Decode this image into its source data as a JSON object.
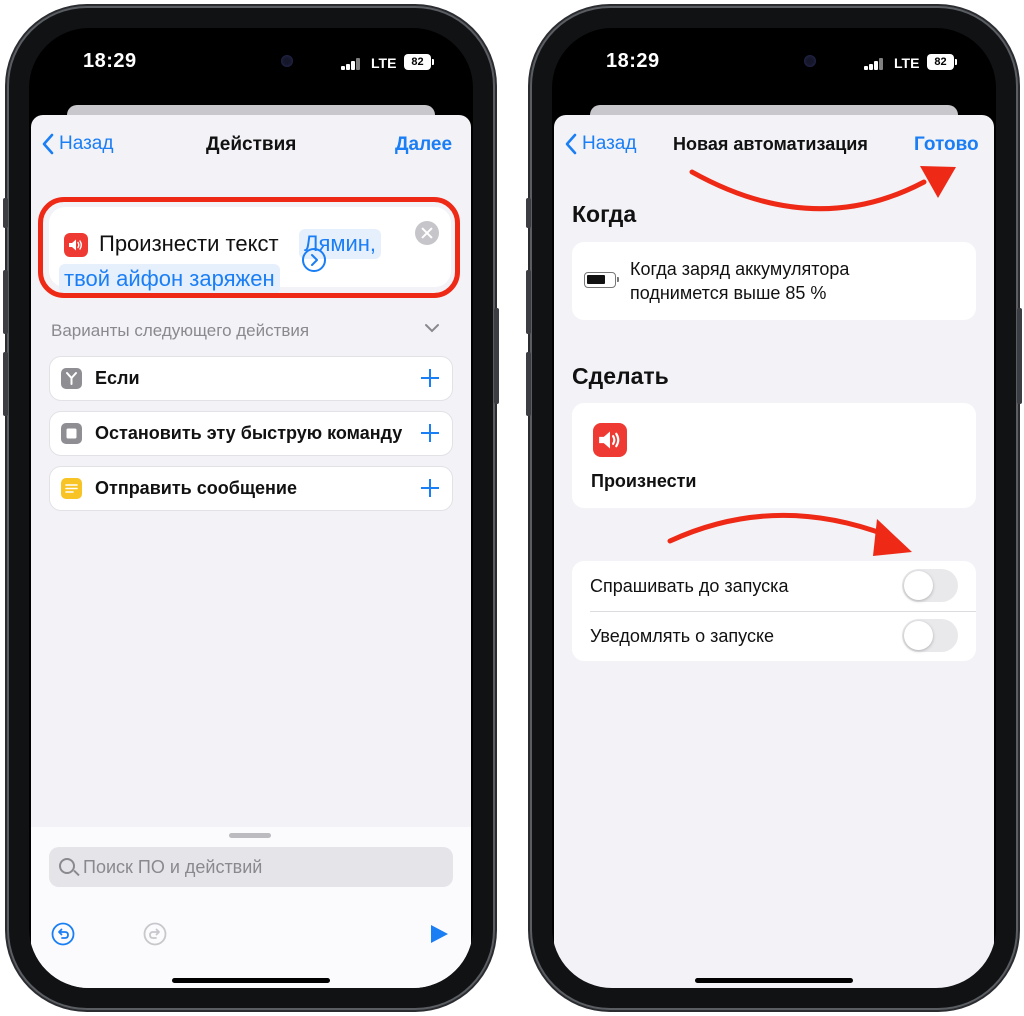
{
  "left_screen": {
    "status": {
      "time": "18:29",
      "network": "LTE",
      "battery": "82"
    },
    "nav": {
      "back": "Назад",
      "title": "Действия",
      "next": "Далее"
    },
    "action": {
      "icon": "speaker-icon",
      "name": "Произнести текст",
      "text_part1": "Лямин,",
      "text_part2": "твой айфон заряжен"
    },
    "suggestions_title": "Варианты следующего действия",
    "suggestions": [
      {
        "label": "Если",
        "icon": "branch-icon",
        "color": "#8e8e93"
      },
      {
        "label": "Остановить эту быструю команду",
        "icon": "stop-icon",
        "color": "#8e8e93"
      },
      {
        "label": "Отправить сообщение",
        "icon": "note-icon",
        "color": "#f7c325"
      }
    ],
    "search": {
      "placeholder": "Поиск ПО и действий"
    }
  },
  "right_screen": {
    "status": {
      "time": "18:29",
      "network": "LTE",
      "battery": "82"
    },
    "nav": {
      "back": "Назад",
      "title": "Новая автоматизация",
      "done": "Готово"
    },
    "when": {
      "heading": "Когда",
      "line1": "Когда заряд аккумулятора",
      "line2": "поднимется выше 85 %"
    },
    "do": {
      "heading": "Сделать",
      "action": "Произнести"
    },
    "options": [
      {
        "label": "Спрашивать до запуска",
        "on": false
      },
      {
        "label": "Уведомлять о запуске",
        "on": false
      }
    ]
  },
  "colors": {
    "accent": "#1a7ef5",
    "highlight": "#ee2a17",
    "speaker": "#ee3a32",
    "background": "#f2f2f7"
  }
}
